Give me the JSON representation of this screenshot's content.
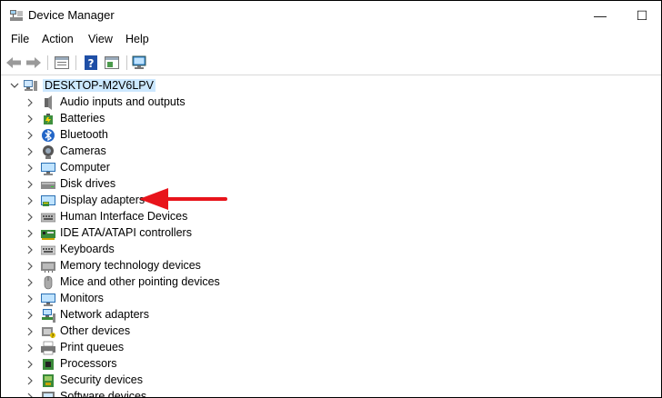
{
  "window": {
    "title": "Device Manager",
    "minimize": "—",
    "maximize": "☐",
    "close": "✕"
  },
  "menu": [
    "File",
    "Action",
    "View",
    "Help"
  ],
  "toolbar": [
    {
      "icon": "back-arrow-icon"
    },
    {
      "icon": "forward-arrow-icon"
    },
    {
      "icon": "properties-icon"
    },
    {
      "icon": "help-icon"
    },
    {
      "icon": "update-driver-icon"
    },
    {
      "icon": "scan-hardware-icon"
    }
  ],
  "tree": {
    "root": {
      "label": "DESKTOP-M2V6LPV",
      "expanded": true
    },
    "categories": [
      {
        "label": "Audio inputs and outputs",
        "icon": "speaker-icon"
      },
      {
        "label": "Batteries",
        "icon": "battery-icon"
      },
      {
        "label": "Bluetooth",
        "icon": "bluetooth-icon"
      },
      {
        "label": "Cameras",
        "icon": "camera-icon"
      },
      {
        "label": "Computer",
        "icon": "computer-icon"
      },
      {
        "label": "Disk drives",
        "icon": "disk-drive-icon"
      },
      {
        "label": "Display adapters",
        "icon": "display-adapter-icon"
      },
      {
        "label": "Human Interface Devices",
        "icon": "hid-icon"
      },
      {
        "label": "IDE ATA/ATAPI controllers",
        "icon": "ide-controller-icon"
      },
      {
        "label": "Keyboards",
        "icon": "keyboard-icon"
      },
      {
        "label": "Memory technology devices",
        "icon": "memory-icon"
      },
      {
        "label": "Mice and other pointing devices",
        "icon": "mouse-icon"
      },
      {
        "label": "Monitors",
        "icon": "monitor-icon"
      },
      {
        "label": "Network adapters",
        "icon": "network-adapter-icon"
      },
      {
        "label": "Other devices",
        "icon": "other-devices-icon"
      },
      {
        "label": "Print queues",
        "icon": "printer-icon"
      },
      {
        "label": "Processors",
        "icon": "processor-icon"
      },
      {
        "label": "Security devices",
        "icon": "security-device-icon"
      },
      {
        "label": "Software devices",
        "icon": "software-device-icon"
      }
    ]
  },
  "annotation": {
    "color": "#e8141b",
    "points_to": "Display adapters"
  }
}
